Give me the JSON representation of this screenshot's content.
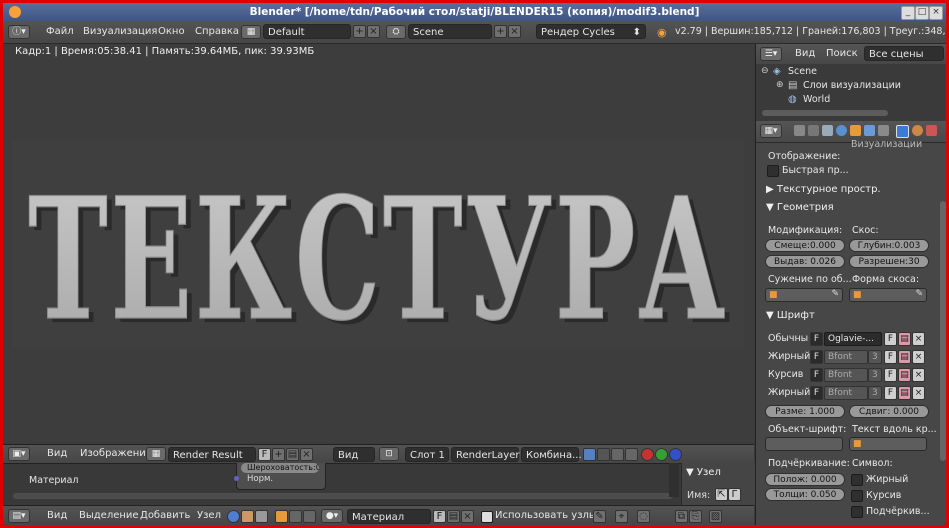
{
  "window": {
    "title": "Blender* [/home/tdn/Рабочий стол/statji/BLENDER15 (копия)/modif3.blend]"
  },
  "info_header": {
    "menus": [
      "Файл",
      "Визуализация",
      "Окно",
      "Справка"
    ],
    "screen_layout": "Default",
    "scene": "Scene",
    "render_engine": "Рендер Cycles",
    "stats": "v2.79 | Вершин:185,712 | Граней:176,803 | Треуг.:348,164 | Объ"
  },
  "viewport": {
    "render_stats": "Кадр:1 | Время:05:38.41 | Память:39.64МБ, пик: 39.93МБ",
    "render_text": "ТЕКСТУРА"
  },
  "image_editor_header": {
    "view": "Вид",
    "image": "Изображение",
    "image_name": "Render Result",
    "f_label": "F",
    "view_mode": "Вид",
    "slot": "Слот 1",
    "render_layer": "RenderLayer",
    "pass": "Комбина..."
  },
  "node_editor": {
    "material_label": "Материал",
    "node_rows": [
      "Шероховатость:0.200",
      "Норм."
    ],
    "side_panel": {
      "header": "Узел",
      "name_label": "Имя:"
    }
  },
  "node_header": {
    "menus": [
      "Вид",
      "Выделение",
      "Добавить",
      "Узел"
    ],
    "material": "Материал",
    "f_label": "F",
    "use_nodes": "Использовать узлы"
  },
  "outliner": {
    "menus": [
      "Вид",
      "Поиск"
    ],
    "filter": "Все сцены",
    "items": [
      {
        "label": "Scene"
      },
      {
        "label": "Слои визуализации"
      },
      {
        "label": "World"
      }
    ]
  },
  "properties": {
    "cut_label": "Визуализации",
    "display_label": "Отображение:",
    "fast_preview": "Быстрая пр...",
    "section_texture_space": "Текстурное простр.",
    "section_geometry": "Геометрия",
    "modification_label": "Модификация:",
    "bevel_label": "Скос:",
    "offset": "Смеще:0.000",
    "depth": "Глубин:0.003",
    "extrude": "Выдав: 0.026",
    "resolution": "Разрешен:30",
    "taper_label": "Сужение по об...",
    "bevel_shape_label": "Форма скоса:",
    "section_font": "Шрифт",
    "font_rows": [
      {
        "label": "Обычны",
        "name": "Oglavie-...",
        "user": ""
      },
      {
        "label": "Жирный",
        "name": "Bfont",
        "user": "3"
      },
      {
        "label": "Курсив",
        "name": "Bfont",
        "user": "3"
      },
      {
        "label": "Жирный",
        "name": "Bfont",
        "user": "3"
      }
    ],
    "size": "Разме: 1.000",
    "shear": "Сдвиг: 0.000",
    "font_object_label": "Объект-шрифт:",
    "text_on_curve_label": "Текст вдоль кр...",
    "underline_label": "Подчёркивание:",
    "underline_position": "Полож: 0.000",
    "underline_thickness": "Толщи: 0.050",
    "symbols_label": "Символ:",
    "symbols": [
      "Жирный",
      "Курсив",
      "Подчёркив..."
    ]
  }
}
